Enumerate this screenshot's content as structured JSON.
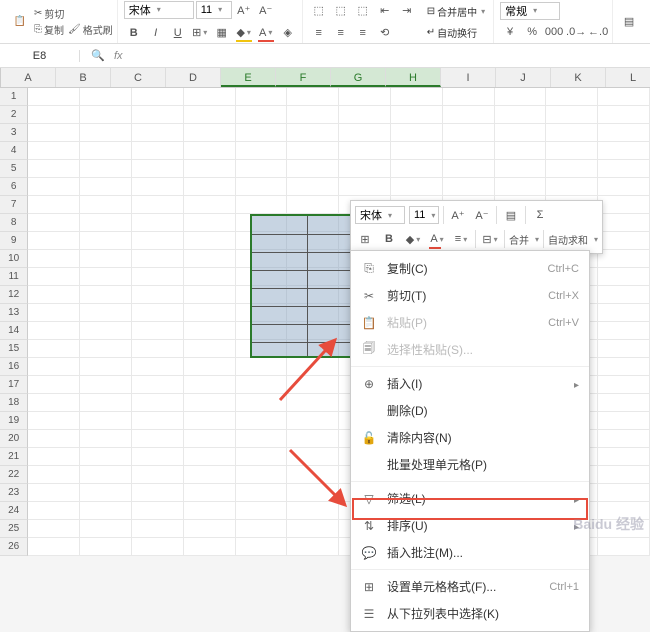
{
  "ribbon": {
    "cut": "剪切",
    "copy": "复制",
    "format_painter": "格式刷",
    "font_name": "宋体",
    "font_size": "11",
    "merge_center": "合并居中",
    "wrap": "自动换行",
    "number_format": "常规"
  },
  "formula_bar": {
    "cell_ref": "E8"
  },
  "columns": [
    "A",
    "B",
    "C",
    "D",
    "E",
    "F",
    "G",
    "H",
    "I",
    "J",
    "K",
    "L"
  ],
  "selected_cols": [
    "E",
    "F",
    "G",
    "H"
  ],
  "mini_toolbar": {
    "font_name": "宋体",
    "font_size": "11",
    "merge": "合并",
    "autosum": "自动求和"
  },
  "context_menu": {
    "items": [
      {
        "icon": "copy",
        "label": "复制(C)",
        "shortcut": "Ctrl+C",
        "enabled": true
      },
      {
        "icon": "cut",
        "label": "剪切(T)",
        "shortcut": "Ctrl+X",
        "enabled": true
      },
      {
        "icon": "paste",
        "label": "粘贴(P)",
        "shortcut": "Ctrl+V",
        "enabled": false
      },
      {
        "icon": "paste-special",
        "label": "选择性粘贴(S)...",
        "shortcut": "",
        "enabled": false
      },
      {
        "sep": true
      },
      {
        "icon": "insert",
        "label": "插入(I)",
        "shortcut": "",
        "enabled": true,
        "submenu": true
      },
      {
        "icon": "delete",
        "label": "删除(D)",
        "shortcut": "",
        "enabled": true
      },
      {
        "icon": "clear",
        "label": "清除内容(N)",
        "shortcut": "",
        "enabled": true
      },
      {
        "icon": "",
        "label": "批量处理单元格(P)",
        "shortcut": "",
        "enabled": true
      },
      {
        "sep": true
      },
      {
        "icon": "filter",
        "label": "筛选(L)",
        "shortcut": "",
        "enabled": true,
        "submenu": true
      },
      {
        "icon": "sort",
        "label": "排序(U)",
        "shortcut": "",
        "enabled": true,
        "submenu": true
      },
      {
        "icon": "comment",
        "label": "插入批注(M)...",
        "shortcut": "",
        "enabled": true
      },
      {
        "sep": true
      },
      {
        "icon": "format",
        "label": "设置单元格格式(F)...",
        "shortcut": "Ctrl+1",
        "enabled": true,
        "highlighted": true
      },
      {
        "icon": "dropdown",
        "label": "从下拉列表中选择(K)",
        "shortcut": "",
        "enabled": true
      }
    ]
  },
  "watermark": "Baidu 经验"
}
